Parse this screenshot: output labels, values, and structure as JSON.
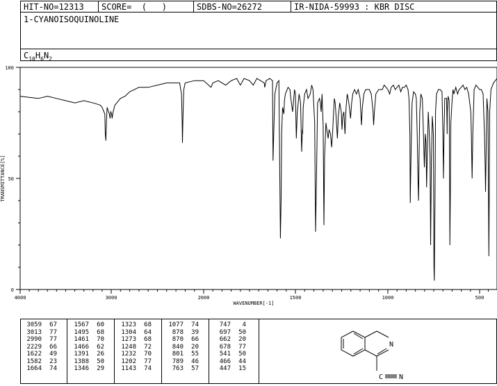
{
  "header": {
    "hit_no": "HIT-NO=12313",
    "score": "SCORE=  (   )",
    "sdbs_no": "SDBS-NO=26272",
    "ir_info": "IR-NIDA-59993 : KBR DISC",
    "compound_name": "1-CYANOISOQUINOLINE",
    "formula_c": "C",
    "formula_c_sub": "10",
    "formula_h": "H",
    "formula_h_sub": "6",
    "formula_n": "N",
    "formula_n_sub": "2"
  },
  "chart_data": {
    "type": "line",
    "title": "",
    "xlabel": "WAVENUMBER[-1]",
    "ylabel": "TRANSMITTANCE[%]",
    "xlim": [
      4000,
      400
    ],
    "ylim": [
      0,
      100
    ],
    "x_ticks": [
      "4000",
      "3000",
      "2000",
      "1500",
      "1000",
      "500"
    ],
    "y_ticks": [
      "100",
      "50",
      "0"
    ],
    "grid": false,
    "series": [
      {
        "points": [
          [
            4000,
            87
          ],
          [
            3900,
            86.5
          ],
          [
            3800,
            86
          ],
          [
            3700,
            87
          ],
          [
            3600,
            86
          ],
          [
            3500,
            85
          ],
          [
            3400,
            84
          ],
          [
            3300,
            85
          ],
          [
            3200,
            84
          ],
          [
            3120,
            83
          ],
          [
            3100,
            82
          ],
          [
            3080,
            80
          ],
          [
            3070,
            79
          ],
          [
            3065,
            70
          ],
          [
            3059,
            67
          ],
          [
            3053,
            75
          ],
          [
            3045,
            82
          ],
          [
            3030,
            80
          ],
          [
            3020,
            79
          ],
          [
            3013,
            77
          ],
          [
            3005,
            80
          ],
          [
            2995,
            79
          ],
          [
            2990,
            77
          ],
          [
            2980,
            80
          ],
          [
            2960,
            83
          ],
          [
            2940,
            84
          ],
          [
            2900,
            86
          ],
          [
            2850,
            87
          ],
          [
            2800,
            89
          ],
          [
            2700,
            91
          ],
          [
            2600,
            91
          ],
          [
            2500,
            92
          ],
          [
            2400,
            93
          ],
          [
            2300,
            93
          ],
          [
            2260,
            93
          ],
          [
            2240,
            88
          ],
          [
            2232,
            75
          ],
          [
            2229,
            66
          ],
          [
            2224,
            77
          ],
          [
            2215,
            90
          ],
          [
            2200,
            93
          ],
          [
            2100,
            94
          ],
          [
            2000,
            94
          ],
          [
            1960,
            91
          ],
          [
            1950,
            93
          ],
          [
            1920,
            94
          ],
          [
            1880,
            92
          ],
          [
            1850,
            94
          ],
          [
            1820,
            95
          ],
          [
            1800,
            92
          ],
          [
            1780,
            95
          ],
          [
            1750,
            94
          ],
          [
            1730,
            92
          ],
          [
            1710,
            95
          ],
          [
            1690,
            94
          ],
          [
            1670,
            93
          ],
          [
            1667,
            91
          ],
          [
            1660,
            94
          ],
          [
            1640,
            95
          ],
          [
            1625,
            94
          ],
          [
            1622,
            58
          ],
          [
            1618,
            70
          ],
          [
            1612,
            88
          ],
          [
            1600,
            93
          ],
          [
            1590,
            94
          ],
          [
            1582,
            23
          ],
          [
            1578,
            40
          ],
          [
            1575,
            70
          ],
          [
            1570,
            82
          ],
          [
            1565,
            80
          ],
          [
            1563,
            79
          ],
          [
            1560,
            85
          ],
          [
            1555,
            88
          ],
          [
            1540,
            91
          ],
          [
            1530,
            90
          ],
          [
            1525,
            86
          ],
          [
            1515,
            80
          ],
          [
            1505,
            90
          ],
          [
            1500,
            88
          ],
          [
            1495,
            68
          ],
          [
            1490,
            80
          ],
          [
            1480,
            88
          ],
          [
            1472,
            84
          ],
          [
            1466,
            62
          ],
          [
            1462,
            72
          ],
          [
            1461,
            70
          ],
          [
            1458,
            82
          ],
          [
            1450,
            88
          ],
          [
            1440,
            90
          ],
          [
            1432,
            86
          ],
          [
            1420,
            88
          ],
          [
            1412,
            92
          ],
          [
            1405,
            90
          ],
          [
            1396,
            75
          ],
          [
            1391,
            26
          ],
          [
            1386,
            50
          ],
          [
            1380,
            84
          ],
          [
            1370,
            86
          ],
          [
            1365,
            84
          ],
          [
            1361,
            80
          ],
          [
            1356,
            88
          ],
          [
            1350,
            74
          ],
          [
            1346,
            29
          ],
          [
            1342,
            60
          ],
          [
            1335,
            75
          ],
          [
            1330,
            72
          ],
          [
            1323,
            68
          ],
          [
            1318,
            72
          ],
          [
            1310,
            70
          ],
          [
            1304,
            64
          ],
          [
            1298,
            72
          ],
          [
            1290,
            86
          ],
          [
            1285,
            84
          ],
          [
            1280,
            78
          ],
          [
            1276,
            72
          ],
          [
            1273,
            68
          ],
          [
            1268,
            78
          ],
          [
            1260,
            84
          ],
          [
            1252,
            80
          ],
          [
            1248,
            72
          ],
          [
            1244,
            78
          ],
          [
            1238,
            80
          ],
          [
            1232,
            70
          ],
          [
            1226,
            82
          ],
          [
            1220,
            88
          ],
          [
            1215,
            86
          ],
          [
            1208,
            82
          ],
          [
            1202,
            77
          ],
          [
            1196,
            84
          ],
          [
            1190,
            88
          ],
          [
            1180,
            90
          ],
          [
            1170,
            88
          ],
          [
            1160,
            90
          ],
          [
            1150,
            86
          ],
          [
            1143,
            74
          ],
          [
            1138,
            82
          ],
          [
            1130,
            88
          ],
          [
            1120,
            90
          ],
          [
            1100,
            90
          ],
          [
            1090,
            88
          ],
          [
            1080,
            80
          ],
          [
            1077,
            74
          ],
          [
            1073,
            80
          ],
          [
            1065,
            88
          ],
          [
            1050,
            90
          ],
          [
            1030,
            90
          ],
          [
            1020,
            92
          ],
          [
            1000,
            90
          ],
          [
            990,
            88
          ],
          [
            982,
            91
          ],
          [
            970,
            92
          ],
          [
            960,
            90
          ],
          [
            950,
            91
          ],
          [
            940,
            92
          ],
          [
            930,
            89
          ],
          [
            920,
            91
          ],
          [
            910,
            91
          ],
          [
            900,
            92
          ],
          [
            890,
            90
          ],
          [
            885,
            86
          ],
          [
            880,
            70
          ],
          [
            878,
            39
          ],
          [
            874,
            60
          ],
          [
            868,
            84
          ],
          [
            860,
            89
          ],
          [
            850,
            88
          ],
          [
            845,
            86
          ],
          [
            840,
            70
          ],
          [
            836,
            50
          ],
          [
            833,
            40
          ],
          [
            830,
            60
          ],
          [
            826,
            80
          ],
          [
            820,
            88
          ],
          [
            812,
            86
          ],
          [
            806,
            70
          ],
          [
            801,
            55
          ],
          [
            796,
            70
          ],
          [
            792,
            66
          ],
          [
            789,
            46
          ],
          [
            785,
            62
          ],
          [
            780,
            80
          ],
          [
            775,
            72
          ],
          [
            770,
            60
          ],
          [
            767,
            20
          ],
          [
            763,
            57
          ],
          [
            758,
            78
          ],
          [
            752,
            70
          ],
          [
            749,
            10
          ],
          [
            747,
            4
          ],
          [
            743,
            40
          ],
          [
            740,
            80
          ],
          [
            735,
            88
          ],
          [
            725,
            90
          ],
          [
            715,
            90
          ],
          [
            705,
            89
          ],
          [
            700,
            70
          ],
          [
            697,
            50
          ],
          [
            694,
            70
          ],
          [
            690,
            86
          ],
          [
            680,
            86
          ],
          [
            677,
            70
          ],
          [
            676,
            80
          ],
          [
            672,
            87
          ],
          [
            666,
            85
          ],
          [
            663,
            40
          ],
          [
            662,
            20
          ],
          [
            660,
            40
          ],
          [
            657,
            75
          ],
          [
            650,
            85
          ],
          [
            645,
            90
          ],
          [
            640,
            88
          ],
          [
            630,
            91
          ],
          [
            620,
            88
          ],
          [
            612,
            90
          ],
          [
            600,
            91
          ],
          [
            590,
            92
          ],
          [
            580,
            90
          ],
          [
            570,
            91
          ],
          [
            560,
            88
          ],
          [
            548,
            80
          ],
          [
            545,
            70
          ],
          [
            541,
            50
          ],
          [
            537,
            70
          ],
          [
            530,
            90
          ],
          [
            520,
            92
          ],
          [
            510,
            91
          ],
          [
            500,
            90
          ],
          [
            490,
            90
          ],
          [
            480,
            88
          ],
          [
            472,
            70
          ],
          [
            468,
            55
          ],
          [
            466,
            44
          ],
          [
            463,
            60
          ],
          [
            458,
            86
          ],
          [
            452,
            80
          ],
          [
            449,
            40
          ],
          [
            447,
            15
          ],
          [
            445,
            40
          ],
          [
            442,
            80
          ],
          [
            435,
            90
          ],
          [
            430,
            91
          ],
          [
            420,
            93
          ],
          [
            410,
            94
          ],
          [
            400,
            95
          ]
        ]
      }
    ],
    "peak_table": {
      "columns": [
        [
          [
            "3059",
            "67"
          ],
          [
            "3013",
            "77"
          ],
          [
            "2990",
            "77"
          ],
          [
            "2229",
            "66"
          ],
          [
            "1622",
            "49"
          ],
          [
            "1582",
            "23"
          ],
          [
            "1664",
            "74"
          ]
        ],
        [
          [
            "1567",
            "60"
          ],
          [
            "1495",
            "68"
          ],
          [
            "1461",
            "70"
          ],
          [
            "1466",
            "62"
          ],
          [
            "1391",
            "26"
          ],
          [
            "1388",
            "50"
          ],
          [
            "1346",
            "29"
          ]
        ],
        [
          [
            "1323",
            "68"
          ],
          [
            "1304",
            "64"
          ],
          [
            "1273",
            "68"
          ],
          [
            "1248",
            "72"
          ],
          [
            "1232",
            "70"
          ],
          [
            "1202",
            "77"
          ],
          [
            "1143",
            "74"
          ]
        ],
        [
          [
            "1077",
            "74"
          ],
          [
            "878",
            "39"
          ],
          [
            "870",
            "66"
          ],
          [
            "840",
            "20"
          ],
          [
            "801",
            "55"
          ],
          [
            "789",
            "46"
          ],
          [
            "763",
            "57"
          ]
        ],
        [
          [
            "747",
            "4"
          ],
          [
            "697",
            "50"
          ],
          [
            "662",
            "20"
          ],
          [
            "678",
            "77"
          ],
          [
            "541",
            "50"
          ],
          [
            "466",
            "44"
          ],
          [
            "447",
            "15"
          ]
        ]
      ]
    },
    "structure_atom_label": "N",
    "structure_nitrile_c": "C",
    "structure_nitrile_n": "N"
  }
}
